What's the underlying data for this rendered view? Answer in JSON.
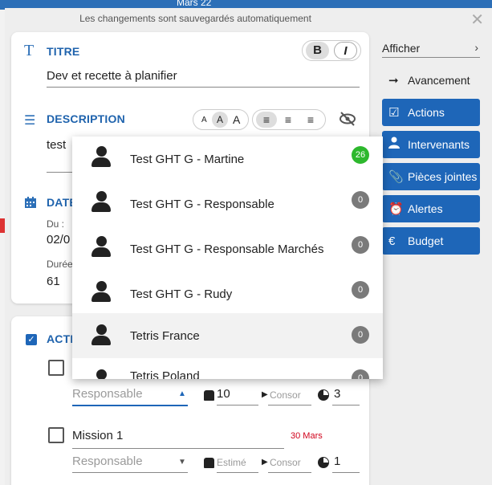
{
  "background": {
    "top_date": "Mars 22"
  },
  "modal": {
    "autosave_text": "Les changements sont sauvegardés automatiquement",
    "close_icon": "close-icon"
  },
  "titre": {
    "section_label": "TITRE",
    "value": "Dev et recette à planifier",
    "bold_btn": "B",
    "italic_btn": "I"
  },
  "description": {
    "section_label": "DESCRIPTION",
    "value": "test",
    "font_small": "A",
    "font_medium": "A",
    "font_large": "A"
  },
  "dates": {
    "section_label": "DATE",
    "du_label": "Du :",
    "du_value": "02/0",
    "duree_label": "Durée",
    "duree_value": "61"
  },
  "actions": {
    "section_label": "ACTI",
    "row1": {
      "responsable_placeholder": "Responsable",
      "charge_value": "10",
      "conso_placeholder": "Consor",
      "pie_value": "3"
    },
    "row2": {
      "title": "Mission 1",
      "date": "30 Mars",
      "responsable_placeholder": "Responsable",
      "estime_placeholder": "Estimé",
      "conso_placeholder": "Consor",
      "pie_value": "1"
    }
  },
  "sidebar": {
    "afficher_label": "Afficher",
    "items": [
      {
        "label": "Avancement",
        "icon": "arrow-right-icon",
        "active": false
      },
      {
        "label": "Actions",
        "icon": "checkbox-icon",
        "active": true
      },
      {
        "label": "Intervenants",
        "icon": "user-icon",
        "active": true
      },
      {
        "label": "Pièces jointes",
        "icon": "paperclip-icon",
        "active": true
      },
      {
        "label": "Alertes",
        "icon": "alarm-clock-icon",
        "active": true
      },
      {
        "label": "Budget",
        "icon": "euro-icon",
        "active": true
      }
    ]
  },
  "dropdown": {
    "items": [
      {
        "label": "Test GHT G - Martine",
        "count": "26",
        "badge_color": "#2db82d"
      },
      {
        "label": "Test GHT G - Responsable",
        "count": "0",
        "badge_color": "#7a7a7a"
      },
      {
        "label": "Test GHT G - Responsable Marchés",
        "count": "0",
        "badge_color": "#7a7a7a"
      },
      {
        "label": "Test GHT G - Rudy",
        "count": "0",
        "badge_color": "#7a7a7a"
      },
      {
        "label": "Tetris France",
        "count": "0",
        "badge_color": "#7a7a7a"
      },
      {
        "label": "Tetris Poland",
        "count": "0",
        "badge_color": "#7a7a7a"
      }
    ]
  },
  "colors": {
    "accent": "#1e66b8",
    "title_blue": "#1f63ad",
    "badge_green": "#2db82d",
    "badge_grey": "#7a7a7a",
    "date_red": "#d0021b"
  }
}
